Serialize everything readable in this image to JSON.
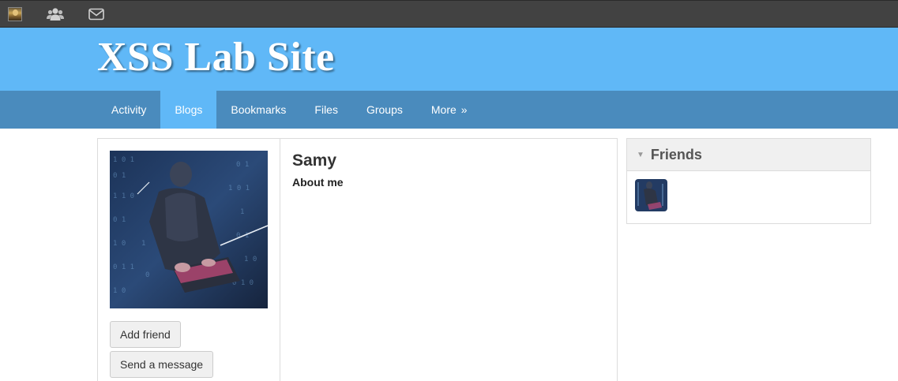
{
  "toolbar": {
    "avatar_icon": "user-avatar-icon",
    "friends_icon": "friends-icon",
    "messages_icon": "envelope-icon"
  },
  "header": {
    "site_title": "XSS Lab Site"
  },
  "nav": {
    "items": [
      {
        "label": "Activity"
      },
      {
        "label": "Blogs"
      },
      {
        "label": "Bookmarks"
      },
      {
        "label": "Files"
      },
      {
        "label": "Groups"
      },
      {
        "label": "More"
      }
    ],
    "more_arrow": "»",
    "active": "Blogs"
  },
  "profile": {
    "name": "Samy",
    "about_label": "About me",
    "add_friend_label": "Add friend",
    "send_message_label": "Send a message"
  },
  "friends": {
    "title": "Friends",
    "toggle_arrow": "▼"
  },
  "colors": {
    "topbar": "#424242",
    "header": "#60b8f7",
    "nav": "#4a8bbd",
    "nav_active": "#60b8f7"
  }
}
